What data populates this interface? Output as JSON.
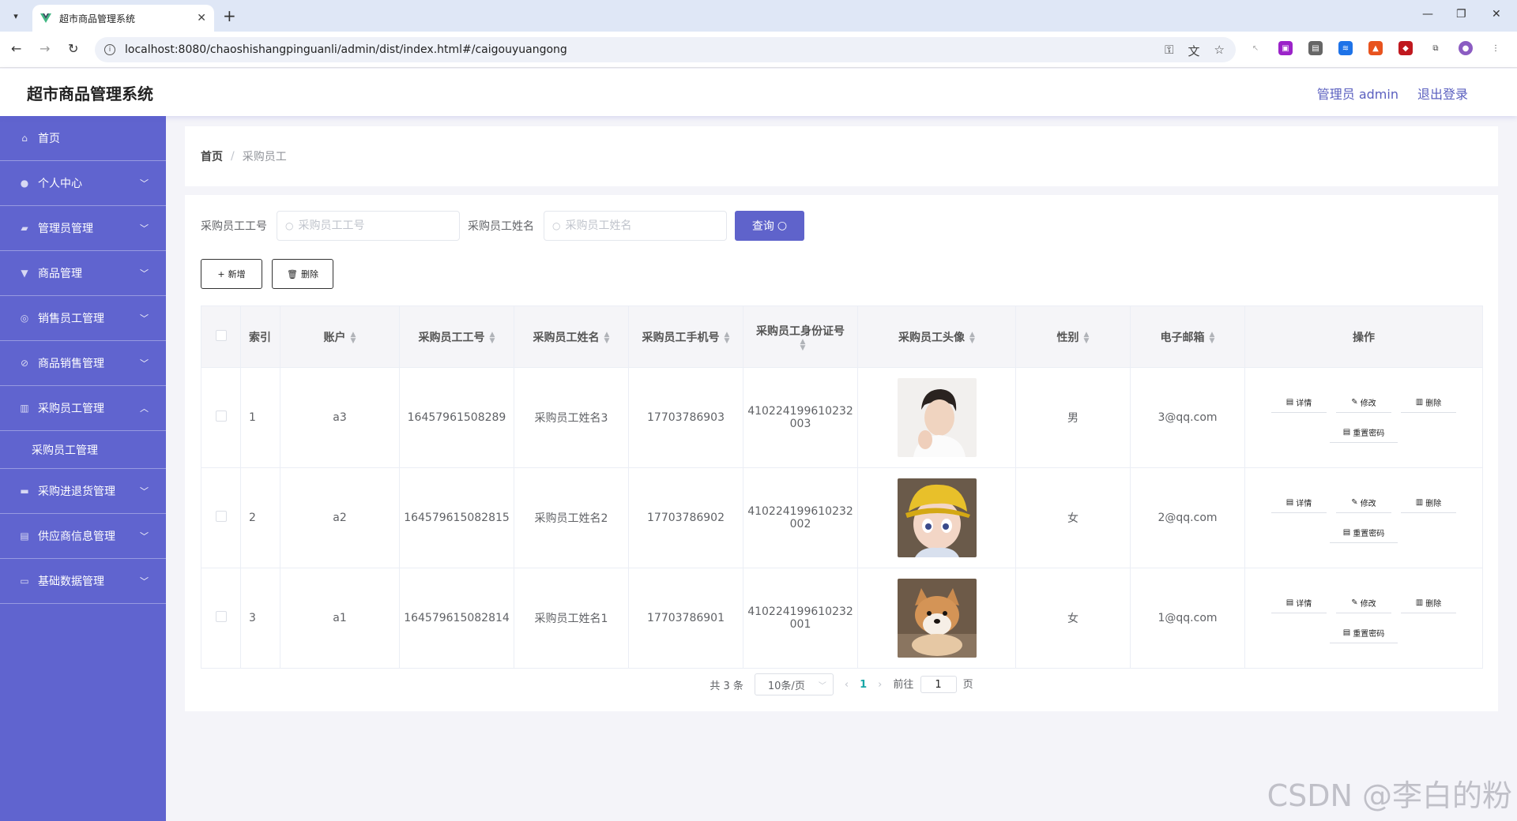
{
  "browser": {
    "tab_title": "超市商品管理系统",
    "url": "localhost:8080/chaoshishangpinguanli/admin/dist/index.html#/caigouyuangong"
  },
  "header": {
    "title": "超市商品管理系统",
    "user": "管理员 admin",
    "logout": "退出登录"
  },
  "sidebar": {
    "items": [
      {
        "label": "首页",
        "icon": "home-icon"
      },
      {
        "label": "个人中心",
        "icon": "user-icon"
      },
      {
        "label": "管理员管理",
        "icon": "briefcase-icon"
      },
      {
        "label": "商品管理",
        "icon": "goods-icon"
      },
      {
        "label": "销售员工管理",
        "icon": "circle-icon"
      },
      {
        "label": "商品销售管理",
        "icon": "compass-icon"
      },
      {
        "label": "采购员工管理",
        "icon": "chart-icon"
      },
      {
        "label": "采购进退货管理",
        "icon": "truck-icon"
      },
      {
        "label": "供应商信息管理",
        "icon": "doc-icon"
      },
      {
        "label": "基础数据管理",
        "icon": "card-icon"
      }
    ],
    "sub_item": "采购员工管理"
  },
  "breadcrumb": {
    "home": "首页",
    "sep": "/",
    "current": "采购员工"
  },
  "search": {
    "label_id": "采购员工工号",
    "placeholder_id": "采购员工工号",
    "label_name": "采购员工姓名",
    "placeholder_name": "采购员工姓名",
    "query": "查询"
  },
  "actions": {
    "add": "新增",
    "delete": "删除"
  },
  "table": {
    "headers": {
      "index": "索引",
      "account": "账户",
      "id": "采购员工工号",
      "name": "采购员工姓名",
      "phone": "采购员工手机号",
      "idcard": "采购员工身份证号",
      "avatar": "采购员工头像",
      "gender": "性别",
      "email": "电子邮箱",
      "ops": "操作"
    },
    "rows": [
      {
        "index": "1",
        "account": "a3",
        "id": "16457961508289",
        "name": "采购员工姓名3",
        "phone": "17703786903",
        "idcard1": "410224199610232",
        "idcard2": "003",
        "gender": "男",
        "email": "3@qq.com"
      },
      {
        "index": "2",
        "account": "a2",
        "id": "164579615082815",
        "name": "采购员工姓名2",
        "phone": "17703786902",
        "idcard1": "410224199610232",
        "idcard2": "002",
        "gender": "女",
        "email": "2@qq.com"
      },
      {
        "index": "3",
        "account": "a1",
        "id": "164579615082814",
        "name": "采购员工姓名1",
        "phone": "17703786901",
        "idcard1": "410224199610232",
        "idcard2": "001",
        "gender": "女",
        "email": "1@qq.com"
      }
    ],
    "op_labels": {
      "detail": "详情",
      "edit": "修改",
      "delete": "删除",
      "reset": "重置密码"
    }
  },
  "pagination": {
    "total": "共 3 条",
    "page_size": "10条/页",
    "current": "1",
    "goto_prefix": "前往",
    "goto_value": "1",
    "goto_suffix": "页"
  },
  "watermark": "CSDN @李白的粉",
  "colors": {
    "sidebar": "#6064cf",
    "accent": "#5f63cb",
    "page_bg": "#f4f4f9"
  }
}
